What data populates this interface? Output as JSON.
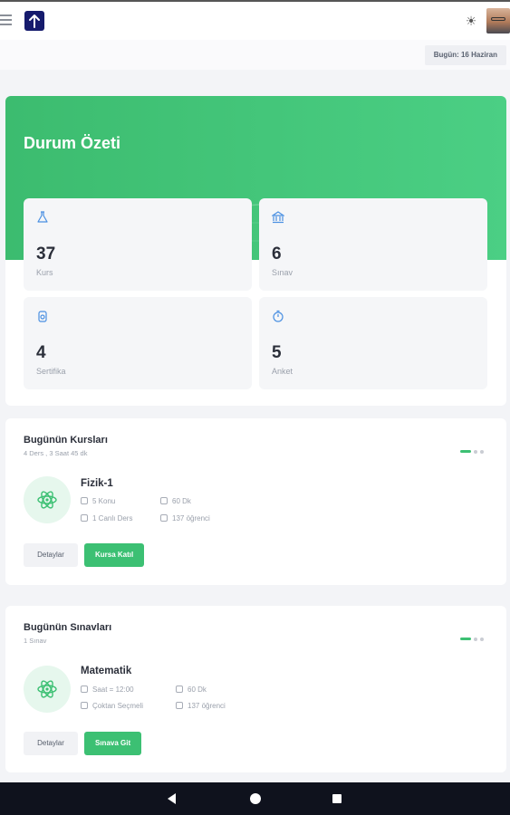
{
  "header": {
    "logo_icon": "arrow-up-logo-icon",
    "theme_icon": "sun-icon",
    "date": "Bugün: 16 Haziran"
  },
  "summary": {
    "title": "Durum Özeti",
    "stats": [
      {
        "icon": "flask-icon",
        "value": "37",
        "label": "Kurs"
      },
      {
        "icon": "bank-icon",
        "value": "6",
        "label": "Sınav"
      },
      {
        "icon": "medal-icon",
        "value": "4",
        "label": "Sertifika"
      },
      {
        "icon": "stopwatch-icon",
        "value": "5",
        "label": "Anket"
      }
    ]
  },
  "courses": {
    "title": "Bugünün Kursları",
    "subtitle": "4 Ders , 3 Saat 45 dk",
    "item": {
      "name": "Fizik-1",
      "meta": [
        "5 Konu",
        "60 Dk",
        "1 Canlı Ders",
        "137 öğrenci"
      ]
    },
    "details_label": "Detaylar",
    "action_label": "Kursa Katıl"
  },
  "exams": {
    "title": "Bugünün Sınavları",
    "subtitle": "1 Sınav",
    "item": {
      "name": "Matematik",
      "meta": [
        "Saat = 12:00",
        "60 Dk",
        "Çoktan Seçmeli",
        "137 öğrenci"
      ]
    },
    "details_label": "Detaylar",
    "action_label": "Sınava Git"
  },
  "colors": {
    "accent": "#3cc073",
    "header_green": "#45c67a",
    "logo_navy": "#161b6d",
    "nav_bar": "#0f121d"
  }
}
